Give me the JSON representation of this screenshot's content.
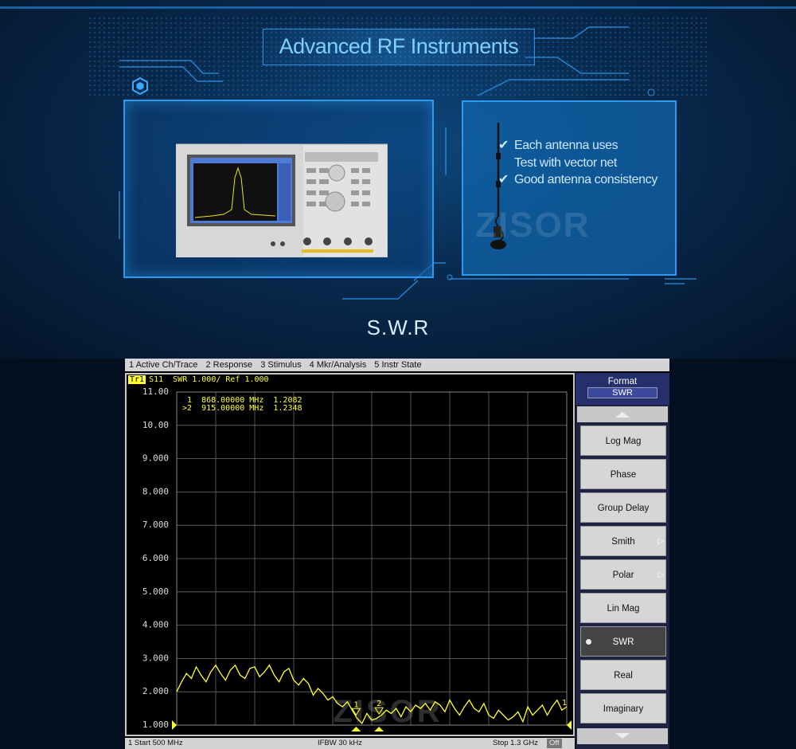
{
  "banner": {
    "title": "Advanced RF Instruments",
    "features": [
      "Each antenna uses",
      "Test with vector net",
      "Good antenna consistency"
    ],
    "watermark": "ZISOR",
    "section_title": "S.W.R"
  },
  "menu": [
    "1 Active Ch/Trace",
    "2 Response",
    "3 Stimulus",
    "4 Mkr/Analysis",
    "5 Instr State"
  ],
  "trace": {
    "tag": "Tr1",
    "header": "S11  SWR 1.000/ Ref 1.000"
  },
  "markers": [
    {
      "line": " 1  868.00000 MHz  1.2082"
    },
    {
      "line": ">2  915.00000 MHz  1.2348"
    }
  ],
  "status": {
    "start": "1  Start 500 MHz",
    "ifbw": "IFBW 30 kHz",
    "stop": "Stop 1.3 GHz",
    "off": "Off"
  },
  "softkeys": {
    "title": "Format",
    "value": "SWR",
    "items": [
      "Log Mag",
      "Phase",
      "Group Delay",
      "Smith",
      "Polar",
      "Lin Mag",
      "SWR",
      "Real",
      "Imaginary"
    ],
    "active": "SWR"
  },
  "chart_data": {
    "type": "line",
    "title": "",
    "xlabel": "",
    "ylabel": "",
    "xlim": [
      500,
      1300
    ],
    "ylim": [
      1.0,
      11.0
    ],
    "y_ticks": [
      "11.00",
      "10.00",
      "9.000",
      "8.000",
      "7.000",
      "6.000",
      "5.000",
      "4.000",
      "3.000",
      "2.000",
      "1.000"
    ],
    "grid": true,
    "line_color": "#ffff33",
    "series": [
      {
        "x": [
          500,
          510,
          520,
          530,
          540,
          550,
          560,
          570,
          580,
          590,
          600,
          610,
          620,
          630,
          640,
          650,
          660,
          670,
          680,
          690,
          700,
          710,
          720,
          730,
          740,
          750,
          760,
          770,
          780,
          790,
          800,
          810,
          820,
          830,
          840,
          850,
          860,
          870,
          880,
          890,
          900,
          910,
          920,
          930,
          940,
          950,
          960,
          970,
          980,
          990,
          1000,
          1010,
          1020,
          1030,
          1040,
          1050,
          1060,
          1070,
          1080,
          1090,
          1100,
          1110,
          1120,
          1130,
          1140,
          1150,
          1160,
          1170,
          1180,
          1190,
          1200,
          1210,
          1220,
          1230,
          1240,
          1250,
          1260,
          1270,
          1280,
          1290,
          1300
        ],
        "y": [
          2.0,
          2.3,
          2.55,
          2.4,
          2.75,
          2.5,
          2.3,
          2.6,
          2.8,
          2.55,
          2.35,
          2.65,
          2.8,
          2.5,
          2.4,
          2.7,
          2.75,
          2.45,
          2.6,
          2.8,
          2.5,
          2.3,
          2.6,
          2.7,
          2.35,
          2.2,
          2.4,
          2.25,
          1.9,
          2.1,
          1.95,
          1.75,
          1.85,
          1.65,
          1.55,
          1.7,
          1.45,
          1.2,
          1.05,
          1.35,
          1.15,
          1.2,
          1.3,
          1.45,
          1.35,
          1.5,
          1.25,
          1.55,
          1.4,
          1.6,
          1.5,
          1.65,
          1.45,
          1.7,
          1.6,
          1.4,
          1.75,
          1.5,
          1.3,
          1.55,
          1.75,
          1.5,
          1.4,
          1.65,
          1.3,
          1.2,
          1.45,
          1.3,
          1.15,
          1.25,
          1.4,
          1.1,
          1.55,
          1.3,
          1.45,
          1.6,
          1.3,
          1.55,
          1.75,
          1.45,
          1.55
        ]
      }
    ],
    "markers": [
      {
        "label": "1",
        "x": 868,
        "y": 1.2082
      },
      {
        "label": "2",
        "x": 915,
        "y": 1.2348
      }
    ]
  }
}
